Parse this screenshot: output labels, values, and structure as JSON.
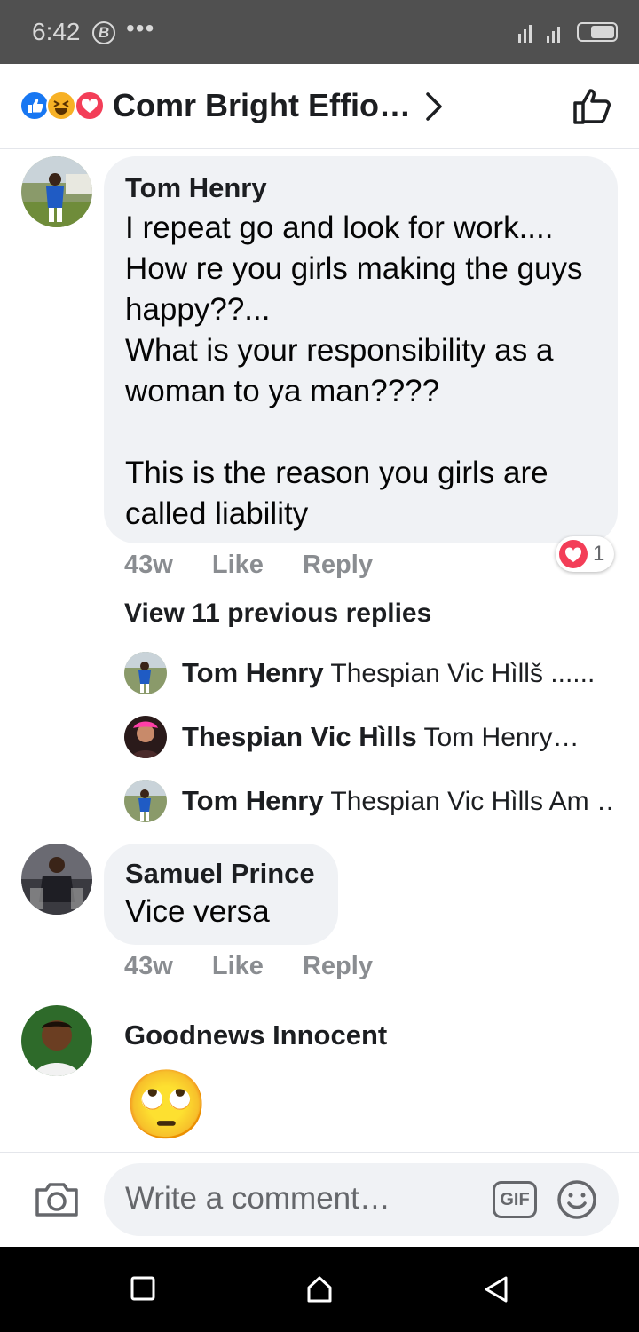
{
  "status_bar": {
    "time": "6:42",
    "b_glyph": "B",
    "overflow": "•••",
    "signal_icon": "signal-bars-icon",
    "battery_icon": "battery-icon"
  },
  "header": {
    "title": "Comr Bright Effio…",
    "reactions": [
      "like-reaction-icon",
      "haha-reaction-icon",
      "love-reaction-icon"
    ],
    "accent": "#1877f2"
  },
  "comments": [
    {
      "author": "Tom Henry",
      "text": "I repeat go and look for work....\nHow re you girls making the guys happy??...\nWhat is your responsibility as a woman to ya man????\n\nThis is the reason you girls are called liability",
      "time": "43w",
      "like": "Like",
      "reply": "Reply",
      "reaction_count": "1"
    },
    {
      "author": "Samuel Prince",
      "text": "Vice versa",
      "time": "43w",
      "like": "Like",
      "reply": "Reply"
    },
    {
      "author": "Goodnews Innocent",
      "emoji": "🙄"
    }
  ],
  "view_previous": "View 11 previous replies",
  "replies": [
    {
      "author": "Tom Henry",
      "preview": "Thespian Vic Hìllš ......"
    },
    {
      "author": "Thespian Vic Hìlls",
      "preview": "Tom Henry…"
    },
    {
      "author": "Tom Henry",
      "preview": "Thespian Vic Hìlls Am …"
    }
  ],
  "composer": {
    "placeholder": "Write a comment…",
    "gif_label": "GIF"
  }
}
